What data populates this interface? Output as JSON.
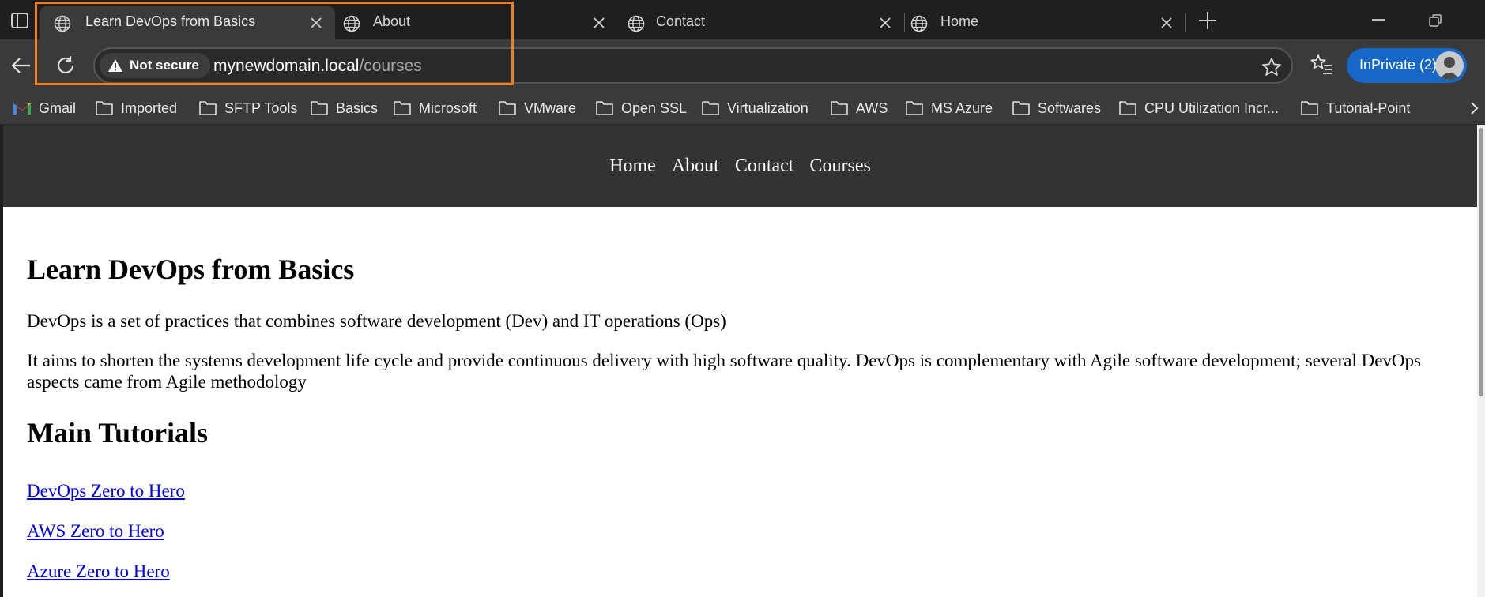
{
  "browser": {
    "tabs": [
      {
        "title": "Learn DevOps from Basics",
        "active": true
      },
      {
        "title": "About",
        "active": false
      },
      {
        "title": "Contact",
        "active": false
      },
      {
        "title": "Home",
        "active": false
      }
    ],
    "address_bar": {
      "security_label": "Not secure",
      "url_host": "mynewdomain.local",
      "url_path": "/courses"
    },
    "profile": {
      "label": "InPrivate (2)"
    },
    "bookmarks": [
      {
        "label": "Gmail",
        "icon": "gmail-icon"
      },
      {
        "label": "Imported",
        "icon": "folder-icon"
      },
      {
        "label": "SFTP Tools",
        "icon": "folder-icon"
      },
      {
        "label": "Basics",
        "icon": "folder-icon"
      },
      {
        "label": "Microsoft",
        "icon": "folder-icon"
      },
      {
        "label": "VMware",
        "icon": "folder-icon"
      },
      {
        "label": "Open SSL",
        "icon": "folder-icon"
      },
      {
        "label": "Virtualization",
        "icon": "folder-icon"
      },
      {
        "label": "AWS",
        "icon": "folder-icon"
      },
      {
        "label": "MS Azure",
        "icon": "folder-icon"
      },
      {
        "label": "Softwares",
        "icon": "folder-icon"
      },
      {
        "label": "CPU Utilization Incr...",
        "icon": "folder-icon"
      },
      {
        "label": "Tutorial-Point",
        "icon": "folder-icon"
      }
    ],
    "colors": {
      "highlight": "#f07f22",
      "inprivate": "#1768c6"
    }
  },
  "page": {
    "nav": [
      "Home",
      "About",
      "Contact",
      "Courses"
    ],
    "heading": "Learn DevOps from Basics",
    "paragraphs": [
      "DevOps is a set of practices that combines software development (Dev) and IT operations (Ops)",
      "It aims to shorten the systems development life cycle and provide continuous delivery with high software quality. DevOps is complementary with Agile software development; several DevOps aspects came from Agile methodology"
    ],
    "subheading": "Main Tutorials",
    "links": [
      "DevOps Zero to Hero",
      "AWS Zero to Hero",
      "Azure Zero to Hero"
    ]
  }
}
